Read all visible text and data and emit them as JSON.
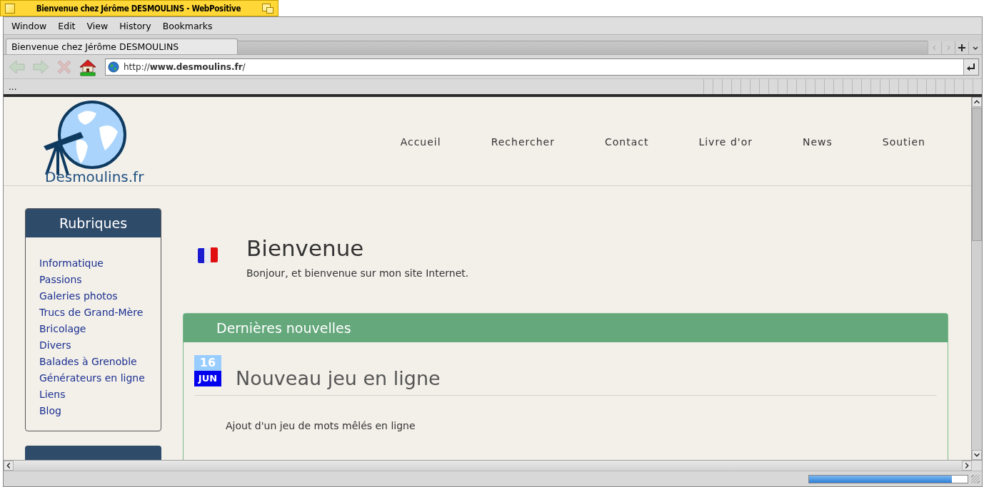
{
  "window": {
    "title": "Bienvenue chez Jérôme DESMOULINS - WebPositive"
  },
  "menu": [
    "Window",
    "Edit",
    "View",
    "History",
    "Bookmarks"
  ],
  "tabs": [
    {
      "label": "Bienvenue chez Jérôme DESMOULINS",
      "selected": true
    }
  ],
  "toolbar": [
    {
      "kind": "back",
      "disabled": true
    },
    {
      "kind": "forward",
      "disabled": true
    },
    {
      "kind": "stop",
      "disabled": true
    },
    {
      "kind": "home",
      "disabled": false
    }
  ],
  "url": "http://**www.desmoulins.fr**/",
  "status_text": "...",
  "page": {
    "logo_text": "Desmoulins.fr",
    "nav": [
      "Accueil",
      "Rechercher",
      "Contact",
      "Livre d'or",
      "News",
      "Soutien"
    ],
    "sidebar": {
      "title": "Rubriques",
      "links": [
        "Informatique",
        "Passions",
        "Galeries photos",
        "Trucs de Grand-Mère",
        "Bricolage",
        "Divers",
        "Balades à Grenoble",
        "Générateurs en ligne",
        "Liens",
        "Blog"
      ]
    },
    "welcome": {
      "title": "Bienvenue",
      "text": "Bonjour, et bienvenue sur mon site Internet."
    },
    "news": {
      "title": "Dernières nouvelles",
      "items": [
        {
          "day": "16",
          "month": "JUN",
          "title": "Nouveau jeu en ligne",
          "text": "Ajout d'un jeu de mots mêlés en ligne"
        }
      ]
    }
  },
  "progress": {
    "level": 0.9
  }
}
